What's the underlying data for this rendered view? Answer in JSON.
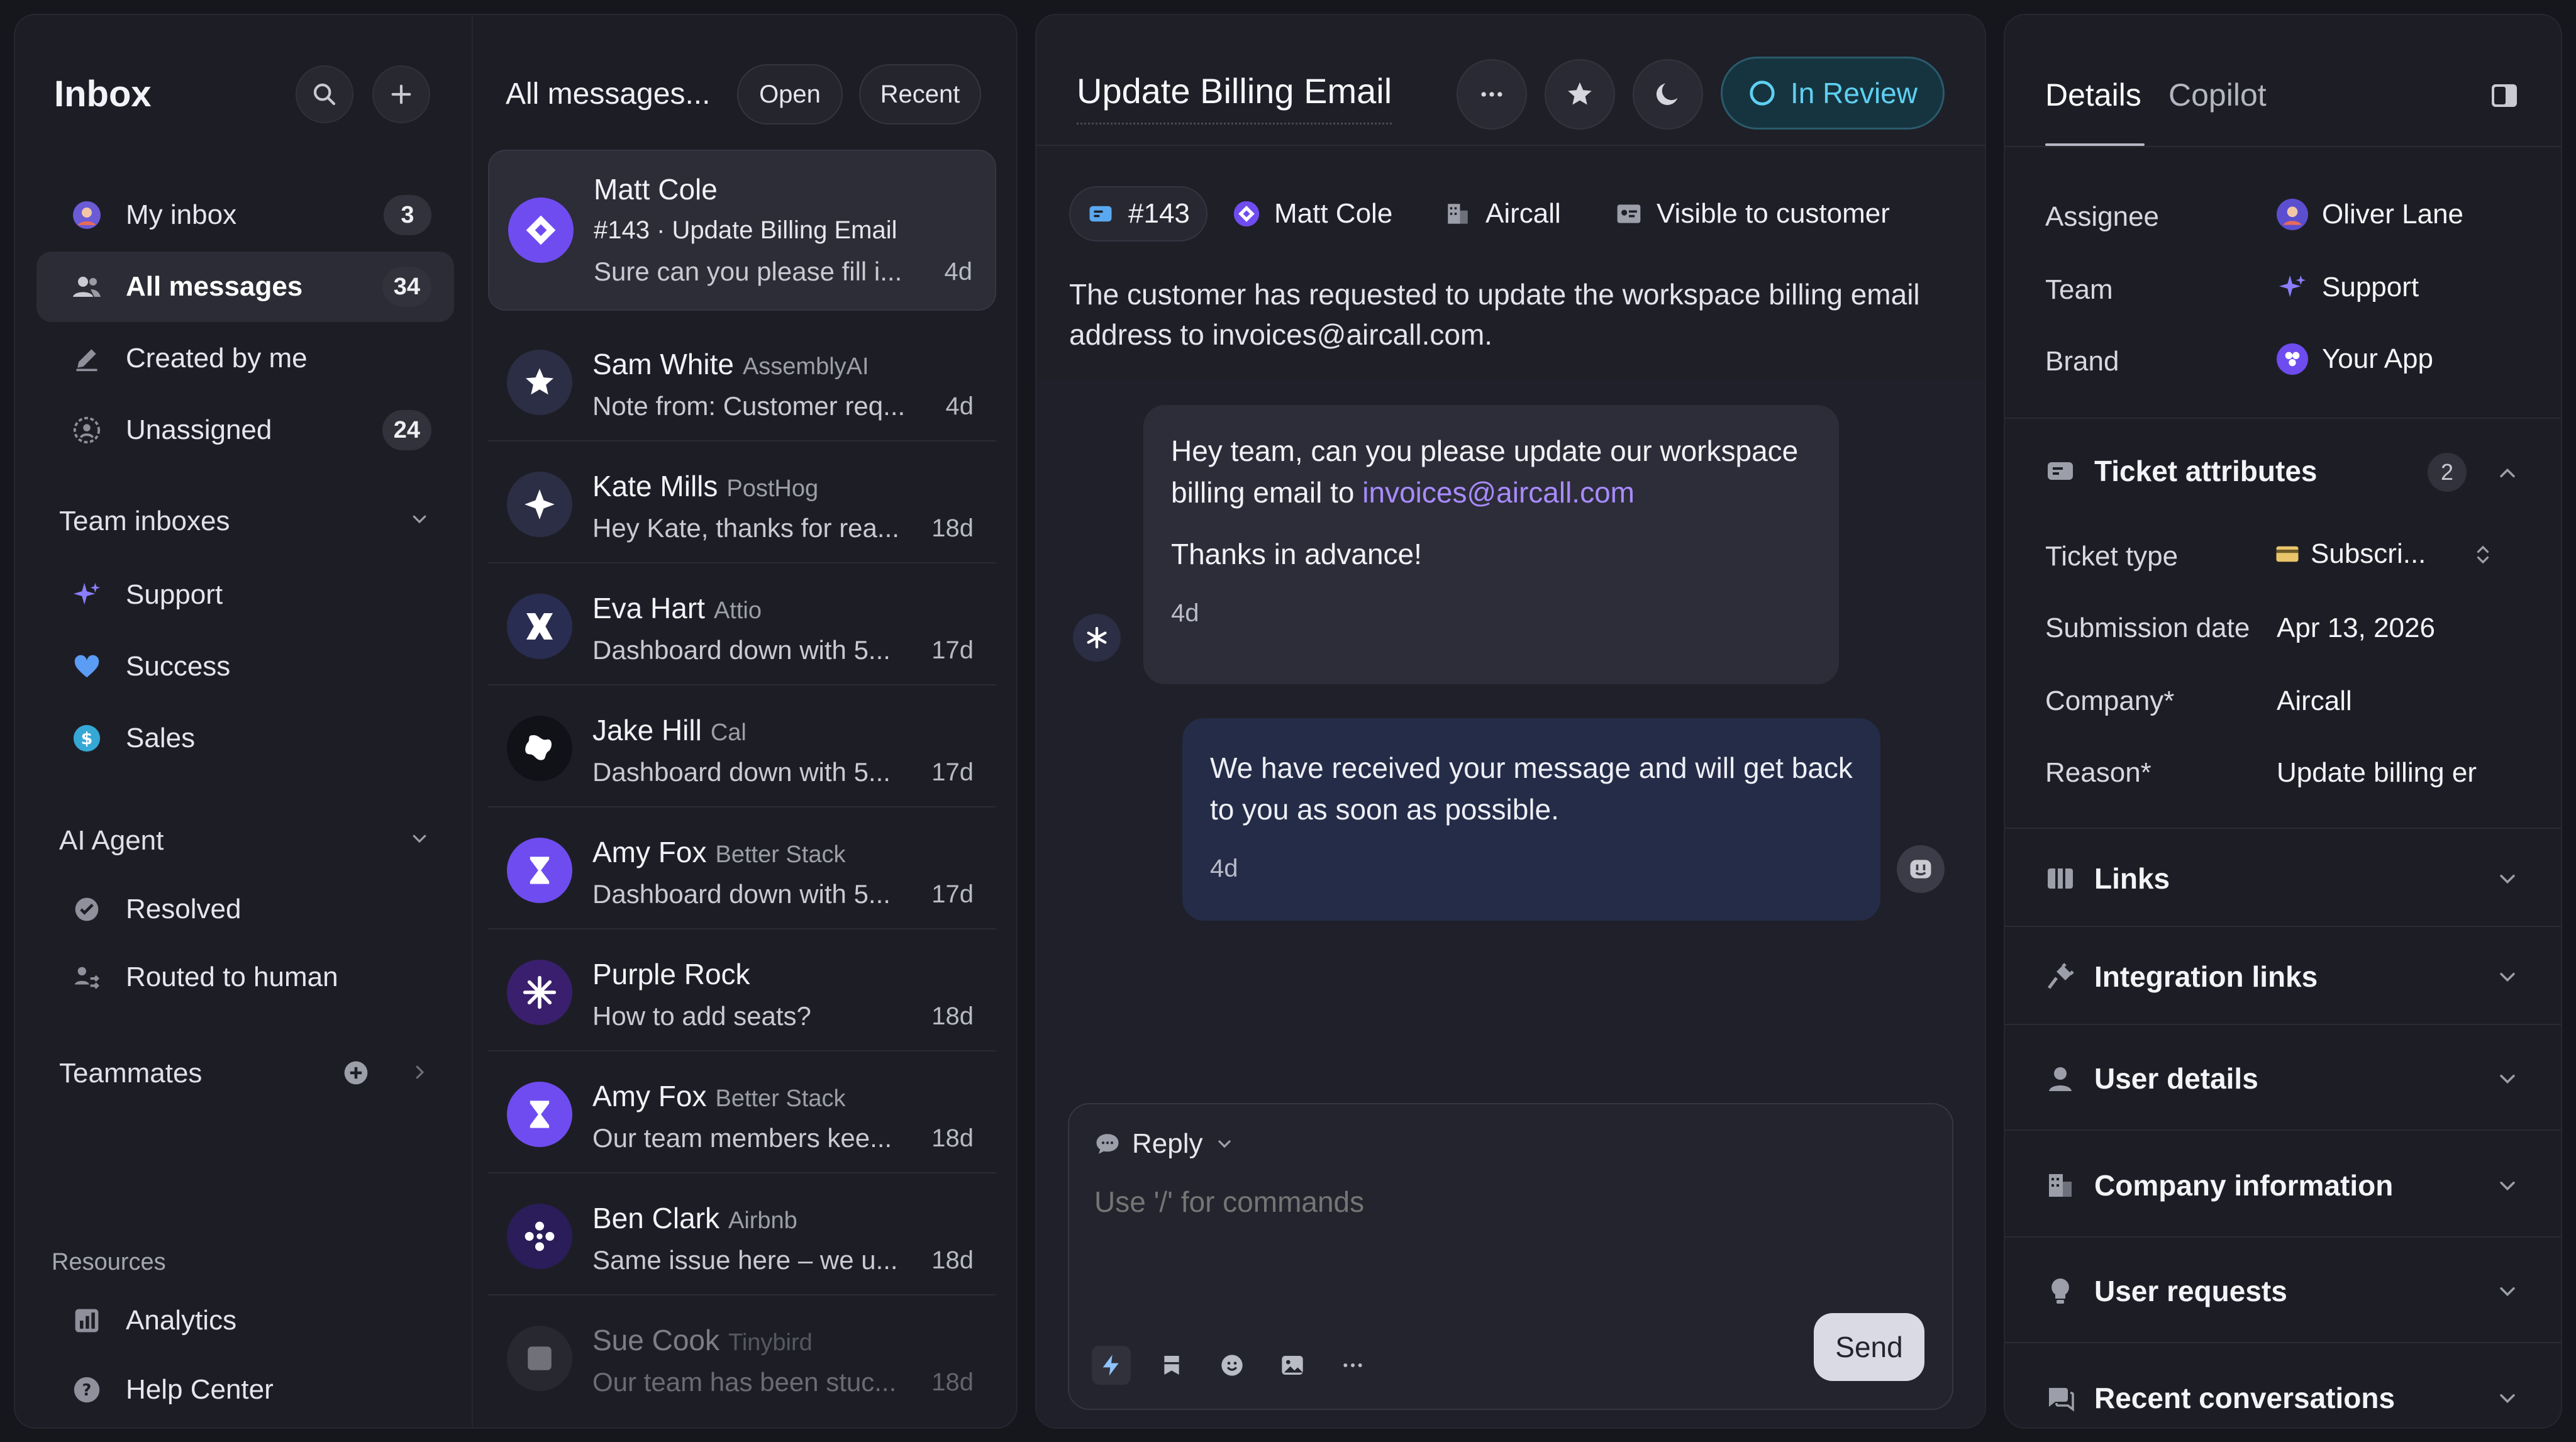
{
  "sidebar": {
    "title": "Inbox",
    "items": [
      {
        "label": "My inbox",
        "count": "3"
      },
      {
        "label": "All messages",
        "count": "34"
      },
      {
        "label": "Created by me"
      },
      {
        "label": "Unassigned",
        "count": "24"
      }
    ],
    "team_inboxes": {
      "title": "Team inboxes",
      "items": [
        {
          "label": "Support"
        },
        {
          "label": "Success"
        },
        {
          "label": "Sales"
        }
      ]
    },
    "ai_agent": {
      "title": "AI Agent",
      "items": [
        {
          "label": "Resolved"
        },
        {
          "label": "Routed to human"
        }
      ]
    },
    "teammates": {
      "title": "Teammates"
    },
    "resources": {
      "title": "Resources",
      "items": [
        {
          "label": "Analytics"
        },
        {
          "label": "Help Center"
        }
      ]
    }
  },
  "message_list": {
    "title": "All messages...",
    "filter_open": "Open",
    "filter_recent": "Recent",
    "messages": [
      {
        "name": "Matt Cole",
        "company": "",
        "subject": "#143 · Update Billing Email",
        "preview": "Sure can you please fill i...",
        "age": "4d"
      },
      {
        "name": "Sam White",
        "company": "AssemblyAI",
        "preview": "Note from: Customer req...",
        "age": "4d"
      },
      {
        "name": "Kate Mills",
        "company": "PostHog",
        "preview": "Hey Kate, thanks for rea...",
        "age": "18d"
      },
      {
        "name": "Eva Hart",
        "company": "Attio",
        "preview": "Dashboard down with 5...",
        "age": "17d"
      },
      {
        "name": "Jake Hill",
        "company": "Cal",
        "preview": "Dashboard down with 5...",
        "age": "17d"
      },
      {
        "name": "Amy Fox",
        "company": "Better Stack",
        "preview": "Dashboard down with 5...",
        "age": "17d"
      },
      {
        "name": "Purple Rock",
        "company": "",
        "preview": "How to add seats?",
        "age": "18d"
      },
      {
        "name": "Amy Fox",
        "company": "Better Stack",
        "preview": "Our team members kee...",
        "age": "18d"
      },
      {
        "name": "Ben Clark",
        "company": "Airbnb",
        "preview": "Same issue here – we u...",
        "age": "18d"
      },
      {
        "name": "Sue Cook",
        "company": "Tinybird",
        "preview": "Our team has been stuc...",
        "age": "18d"
      }
    ]
  },
  "conversation": {
    "title": "Update Billing Email",
    "status": "In Review",
    "ticket_id": "#143",
    "customer": "Matt Cole",
    "company": "Aircall",
    "visibility": "Visible to customer",
    "description": "The customer has requested to update the workspace billing email address to invoices@aircall.com.",
    "customer_message": {
      "line1": "Hey team, can you please update our workspace billing email to ",
      "link": "invoices@aircall.com",
      "line2": "Thanks in advance!",
      "time": "4d"
    },
    "agent_message": {
      "text": "We have received your message and will get back to you as soon as possible.",
      "time": "4d"
    },
    "composer": {
      "mode": "Reply",
      "placeholder": "Use '/' for commands",
      "send_label": "Send"
    }
  },
  "details": {
    "tab_details": "Details",
    "tab_copilot": "Copilot",
    "assignee_label": "Assignee",
    "assignee": "Oliver Lane",
    "team_label": "Team",
    "team": "Support",
    "brand_label": "Brand",
    "brand": "Your App",
    "ticket_attributes": {
      "title": "Ticket attributes",
      "count": "2",
      "ticket_type_label": "Ticket type",
      "ticket_type": "Subscri...",
      "submission_date_label": "Submission date",
      "submission_date": "Apr 13, 2026",
      "company_label": "Company*",
      "company": "Aircall",
      "reason_label": "Reason*",
      "reason": "Update billing er"
    },
    "sections": [
      {
        "label": "Links"
      },
      {
        "label": "Integration links"
      },
      {
        "label": "User details"
      },
      {
        "label": "Company information"
      },
      {
        "label": "User requests"
      },
      {
        "label": "Recent conversations"
      }
    ]
  },
  "colors": {
    "accent_purple": "#7c5cff",
    "status_cyan": "#5fd0f2",
    "link_purple": "#a98bff"
  }
}
